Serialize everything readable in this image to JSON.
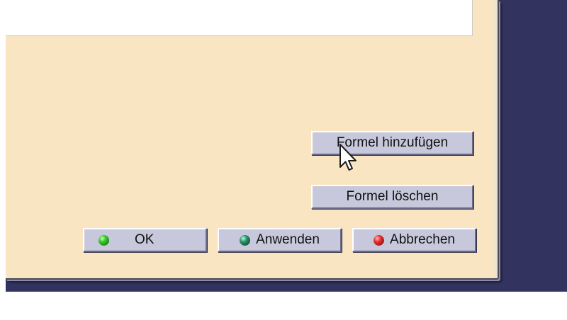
{
  "dialog": {
    "buttons": {
      "add_formula": "Formel hinzufügen",
      "delete_formula": "Formel löschen",
      "ok": "OK",
      "apply": "Anwenden",
      "cancel": "Abbrechen"
    },
    "icons": {
      "ok": "green-ball-icon",
      "apply": "teal-ball-icon",
      "cancel": "red-ball-icon"
    }
  },
  "colors": {
    "dialog_bg": "#f9e5c2",
    "button_bg": "#c8c8dc",
    "desktop_bg": "#33335f"
  },
  "cursor": "arrow-pointer"
}
